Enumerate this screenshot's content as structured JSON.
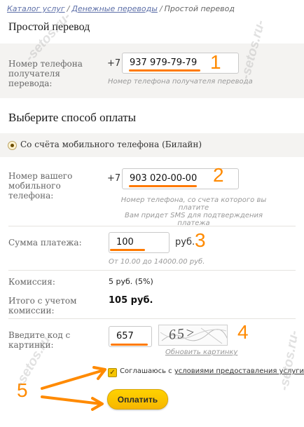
{
  "breadcrumb": {
    "items": [
      "Каталог услуг",
      "Денежные переводы",
      "Простой перевод"
    ],
    "separator": "/"
  },
  "page_title": "Простой перевод",
  "recipient": {
    "label": "Номер телефона получателя перевода:",
    "prefix": "+7",
    "value": "937 979-79-79",
    "hint": "Номер телефона получателя перевода"
  },
  "payment_method": {
    "heading": "Выберите способ оплаты",
    "option_label": "Со счёта мобильного телефона (Билайн)"
  },
  "payer": {
    "label": "Номер вашего мобильного телефона:",
    "prefix": "+7",
    "value": "903 020-00-00",
    "hint_line1": "Номер телефона, со счета которого вы",
    "hint_line2": "платите",
    "hint_line3": "Вам придет SMS для подтверждения платежа"
  },
  "amount": {
    "label": "Сумма платежа:",
    "value": "100",
    "currency": "руб.",
    "hint": "От 10.00 до 14000.00 руб."
  },
  "commission": {
    "label": "Комиссия:",
    "value": "5 руб. (5%)"
  },
  "total": {
    "label": "Итого с учетом комиссии:",
    "value": "105 руб."
  },
  "captcha": {
    "label": "Введите код с картинки:",
    "value": "657",
    "image_text": "65>",
    "refresh_label": "Обновить картинку"
  },
  "agreement": {
    "prefix": "Соглашаюсь с ",
    "link": "условиями предоставления услуги",
    "checked": true
  },
  "submit_label": "Оплатить",
  "annotations": {
    "step1": "1",
    "step2": "2",
    "step3": "3",
    "step4": "4",
    "step5": "5"
  },
  "watermark": "-setos.ru-",
  "colors": {
    "accent_orange": "#ff7a00",
    "button_yellow": "#ffc800",
    "link_blue": "#5d6fa8"
  }
}
